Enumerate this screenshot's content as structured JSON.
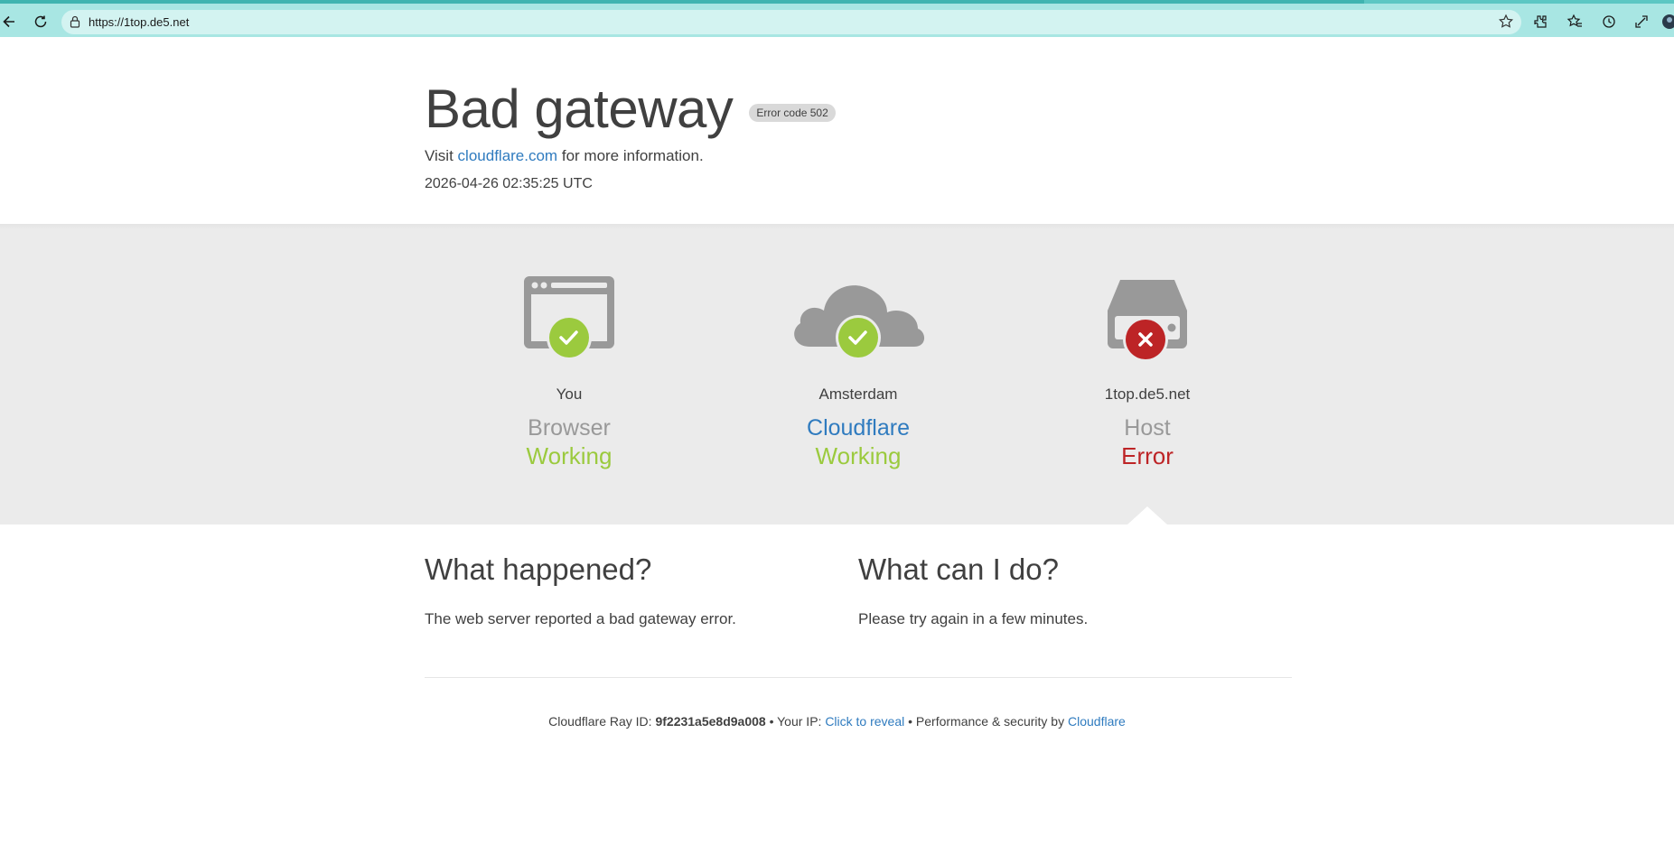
{
  "browser": {
    "url": "https://1top.de5.net",
    "icons": [
      "back-icon",
      "reload-icon",
      "lock-icon",
      "star-icon",
      "extensions-icon",
      "favorites-icon",
      "history-icon",
      "settings-icon",
      "profile-icon"
    ]
  },
  "header": {
    "title": "Bad gateway",
    "error_badge": "Error code 502",
    "visit_prefix": "Visit",
    "visit_link": "cloudflare.com",
    "visit_suffix": "for more information.",
    "timestamp": "2026-04-26 02:35:25 UTC"
  },
  "status": {
    "nodes": [
      {
        "location": "You",
        "type": "Browser",
        "state": "Working",
        "icon": "browser-icon",
        "status_icon": "check-icon"
      },
      {
        "location": "Amsterdam",
        "type": "Cloudflare",
        "state": "Working",
        "icon": "cloud-icon",
        "status_icon": "check-icon"
      },
      {
        "location": "1top.de5.net",
        "type": "Host",
        "state": "Error",
        "icon": "server-icon",
        "status_icon": "x-icon"
      }
    ]
  },
  "what_happened": {
    "heading": "What happened?",
    "text": "The web server reported a bad gateway error."
  },
  "what_can_i_do": {
    "heading": "What can I do?",
    "text": "Please try again in a few minutes."
  },
  "footer": {
    "ray_label": "Cloudflare Ray ID:",
    "ray_id": "9f2231a5e8d9a008",
    "separator": "•",
    "ip_label": "Your IP:",
    "ip_link": "Click to reveal",
    "perf_label": "Performance & security by",
    "perf_link": "Cloudflare"
  },
  "colors": {
    "ok": "#9bca3e",
    "error": "#bd2426",
    "link": "#2f7bbf",
    "icon_gray": "#999999",
    "chrome": "#a8e6e3"
  }
}
